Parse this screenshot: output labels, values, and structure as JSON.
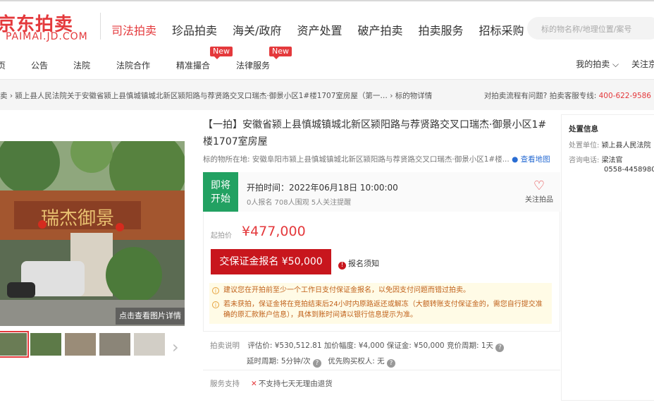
{
  "header": {
    "logo_cn": "京东拍卖",
    "logo_en": "PAIMAI.JD.COM",
    "nav": [
      "司法拍卖",
      "珍品拍卖",
      "海关/政府",
      "资产处置",
      "破产拍卖",
      "拍卖服务",
      "招标采购"
    ],
    "search_placeholder": "标的物名称/地理位置/案号"
  },
  "subnav": {
    "items": [
      "页",
      "公告",
      "法院",
      "法院合作",
      "精准撮合",
      "法律服务"
    ],
    "new_tag": "New",
    "my_auction": "我的拍卖 ⌵",
    "follow": "关注京"
  },
  "breadcrumb": "卖 › 颍上县人民法院关于安徽省颍上县慎城镇城北新区颍阳路与荐贤路交叉口瑞杰·御景小区1#楼1707室房屋（第一…  ›  标的物详情",
  "help": {
    "text": "对拍卖流程有问题? 拍卖客服专线: ",
    "phone": "400-622-9586"
  },
  "gallery": {
    "view_btn": "点击查看图片详情",
    "sign_text": "瑞杰御景"
  },
  "item": {
    "title": "【一拍】安徽省颍上县慎城镇城北新区颍阳路与荐贤路交叉口瑞杰·御景小区1#楼1707室房屋",
    "location_label": "标的物所在地:",
    "location": "安徽阜阳市颍上县慎城镇城北新区颍阳路与荐贤路交叉口瑞杰·御景小区1#楼...",
    "map_link": "查看地图",
    "status_line1": "即将",
    "status_line2": "开始",
    "start_time": "开拍时间：2022年06月18日 10:00:00",
    "meta": "0人报名   708人围观   5人关注提醒",
    "follow_label": "关注拍品",
    "price_label": "起拍价",
    "price": "¥477,000",
    "bid_button": "交保证金报名 ¥50,000",
    "notice_link": "报名须知",
    "tip1": "建议您在开拍前至少一个工作日支付保证金报名，以免因支付问题而错过拍卖。",
    "tip2a": "若未获拍，保证金将在竞拍结束后24小时内原路返还或解冻（大额转账支付保证金的，需您自行提交准",
    "tip2b": "确的原汇款账户信息），具体到账时间请以银行信息提示为准。",
    "desc_label": "拍卖说明",
    "desc_row1": "评估价: ¥530,512.81   加价幅度: ¥4,000   保证金: ¥50,000   竞价周期: 1天",
    "desc_row2a": "延时周期: 5分钟/次",
    "desc_row2b": "优先购买权人: 无",
    "service_label": "服务支持",
    "service_text": "不支持七天无理由退货"
  },
  "disposal": {
    "title": "处置信息",
    "unit_label": "处置单位:",
    "unit": "颍上县人民法院",
    "contact_label": "咨询电话:",
    "contact_name": "梁法官",
    "contact_phone": "0558-4458980"
  }
}
